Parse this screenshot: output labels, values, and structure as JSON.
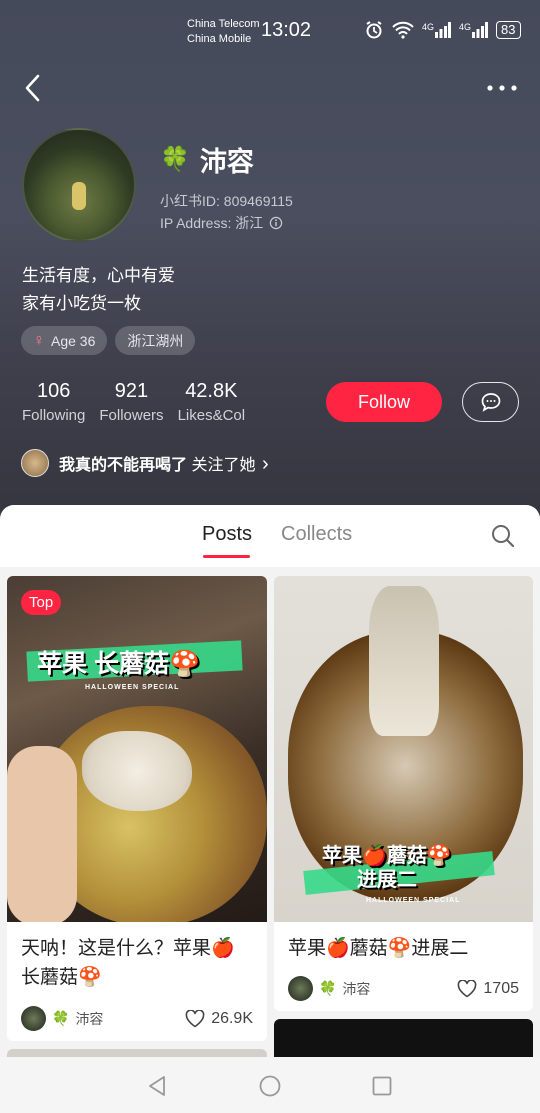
{
  "status_bar": {
    "carrier1": "China Telecom",
    "carrier2": "China Mobile",
    "time": "13:02",
    "network1": "4G",
    "network2": "4G",
    "battery": "83"
  },
  "profile": {
    "name": "沛容",
    "name_emoji": "🍀",
    "red_id": "小红书ID: 809469115",
    "ip": "IP Address: 浙江",
    "bio_line1": "生活有度，心中有爱",
    "bio_line2": "家有小吃货一枚",
    "tags": [
      "Age 36",
      "浙江湖州"
    ],
    "gender_symbol": "♀"
  },
  "stats": [
    {
      "num": "106",
      "label": "Following"
    },
    {
      "num": "921",
      "label": "Followers"
    },
    {
      "num": "42.8K",
      "label": "Likes&Col"
    }
  ],
  "actions": {
    "follow": "Follow"
  },
  "mutual": {
    "name": "我真的不能再喝了",
    "text": "关注了她",
    "chevron": "›"
  },
  "tabs": {
    "posts": "Posts",
    "collects": "Collects"
  },
  "posts": [
    {
      "badge": "Top",
      "overlay": "苹果 长蘑菇🍄",
      "overlay_sub": "HALLOWEEN SPECIAL",
      "title": "天呐！这是什么？苹果🍎长蘑菇🍄",
      "author": "沛容",
      "author_emoji": "🍀",
      "likes": "26.9K"
    },
    {
      "overlay_line1": "苹果🍎蘑菇🍄",
      "overlay_line2": "进展二",
      "overlay_sub": "HALLOWEEN SPECIAL",
      "title": "苹果🍎蘑菇🍄进展二",
      "author": "沛容",
      "author_emoji": "🍀",
      "likes": "1705"
    }
  ],
  "colors": {
    "accent": "#ff2442",
    "header_bg": "#454a5a",
    "band_green": "#36d98a"
  }
}
